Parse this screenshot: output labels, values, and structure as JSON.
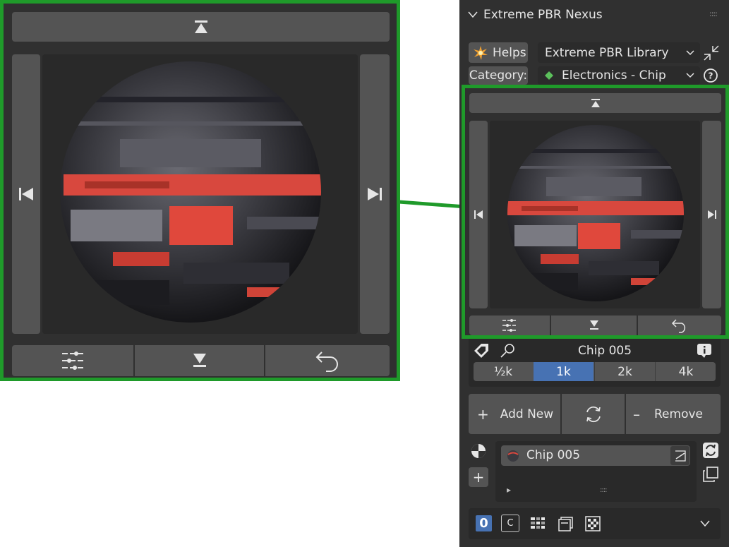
{
  "panel": {
    "title": "Extreme PBR Nexus",
    "collapse_icon": "chevron-down-icon",
    "grip": "::::"
  },
  "helps": {
    "label": "Helps",
    "icon": "burst-icon"
  },
  "library_select": {
    "value": "Extreme PBR Library"
  },
  "category": {
    "label": "Category:",
    "value": "Electronics - Chip"
  },
  "material": {
    "name": "Chip 005"
  },
  "resolutions": {
    "options": [
      "½k",
      "1k",
      "2k",
      "4k"
    ],
    "selected": "1k"
  },
  "actions": {
    "add_label": "Add New",
    "add_symbol": "+",
    "remove_label": "Remove",
    "remove_symbol": "–"
  },
  "slot_list": {
    "item_name": "Chip 005",
    "play_symbol": "▸",
    "grip": "::::"
  },
  "bottom_bar": {
    "zero_label": "0",
    "c_label": "C"
  },
  "colors": {
    "panel_bg": "#303030",
    "button_bg": "#545454",
    "accent": "#4772b3",
    "highlight_green": "#1f9a2a",
    "preview_bg": "#292929"
  }
}
